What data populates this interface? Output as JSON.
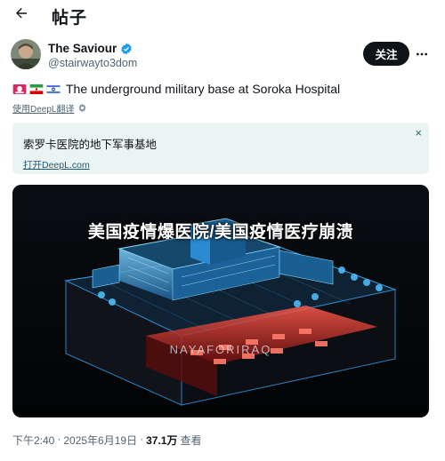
{
  "header": {
    "back_icon": "arrow-left-icon",
    "title": "帖子"
  },
  "author": {
    "name": "The Saviour",
    "verified_icon": "verified-badge-icon",
    "handle": "@stairwayto3dom",
    "follow_label": "关注",
    "more_icon": "more-dots-icon"
  },
  "tweet": {
    "flags": [
      "siren-emoji",
      "iran-flag",
      "israel-flag"
    ],
    "text": "The underground military base at Soroka Hospital",
    "translate_link": "使用DeepL翻译",
    "translation": {
      "text": "索罗卡医院的地下军事基地",
      "link": "打开DeepL.com",
      "close": "×"
    }
  },
  "media": {
    "overlay_title": "美国疫情爆医院/美国疫情医疗崩溃",
    "watermark": "NAYAFORIRAQ"
  },
  "meta": {
    "time": "下午2:40",
    "separator": "·",
    "date": "2025年6月19日",
    "views_count": "37.1万",
    "views_label": "查看"
  },
  "colors": {
    "accent": "#1d9bf0",
    "follow_bg": "#0f1419",
    "translation_bg": "#eaf4f3"
  }
}
